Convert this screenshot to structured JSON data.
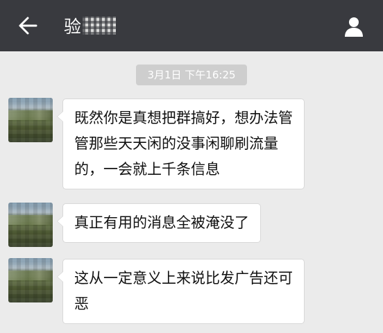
{
  "header": {
    "title": "验",
    "back_icon": "arrow-left-icon",
    "profile_icon": "user-icon",
    "bg_color": "#393a3f"
  },
  "chat": {
    "timestamp": "3月1日 下午16:25",
    "messages": [
      {
        "lines": [
          "既然你是真想把群搞好，想办法管",
          "管那些天天闲的没事闲聊刷流量",
          "的，一会就上千条信息"
        ]
      },
      {
        "lines": [
          "真正有用的消息全被淹没了"
        ]
      },
      {
        "lines": [
          "这从一定意义上来说比发广告还可",
          "恶"
        ]
      }
    ]
  }
}
